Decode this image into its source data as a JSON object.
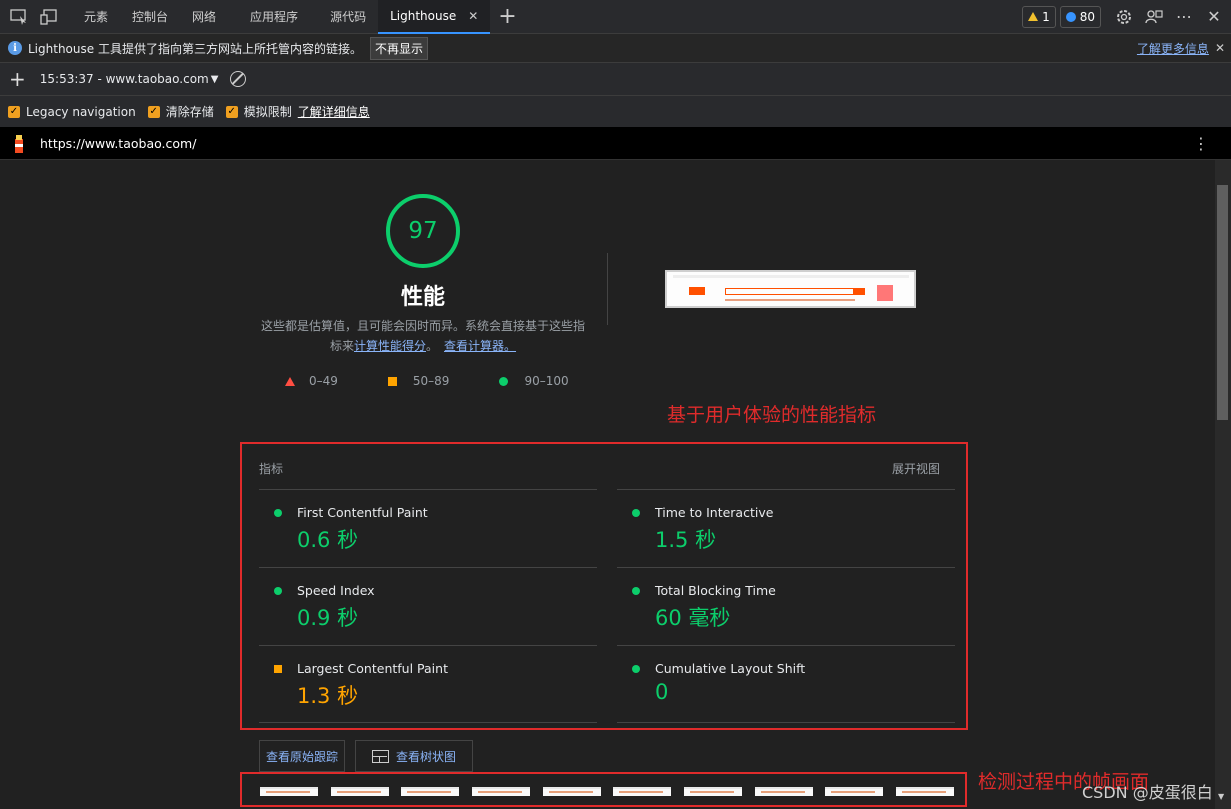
{
  "tabs": {
    "items": [
      "元素",
      "控制台",
      "网络",
      "应用程序",
      "源代码",
      "Lighthouse"
    ],
    "warnings": "1",
    "issues": "80"
  },
  "infobar": {
    "message": "Lighthouse 工具提供了指向第三方网站上所托管内容的链接。",
    "dismiss": "不再显示",
    "learn_more": "了解更多信息"
  },
  "toolbar": {
    "report_select": "15:53:37 - www.taobao.com"
  },
  "options": {
    "legacy": "Legacy navigation",
    "clear_storage": "清除存储",
    "throttling": "模拟限制",
    "learn_more": "了解详细信息"
  },
  "url": "https://www.taobao.com/",
  "summary": {
    "score": "97",
    "title": "性能",
    "desc_1": "这些都是估算值，且可能会因时而异。系统会直接基于这些指",
    "desc_2": "标来",
    "calc_link": "计算性能得分",
    "desc_3": "。",
    "calculator_link": "查看计算器。",
    "legend": [
      "0–49",
      "50–89",
      "90–100"
    ]
  },
  "annotations": {
    "metrics_note": "基于用户体验的性能指标",
    "film_note": "检测过程中的帧画面"
  },
  "metrics": {
    "header": "指标",
    "expand": "展开视图",
    "fcp_label": "First Contentful Paint",
    "fcp_value": "0.6 秒",
    "tti_label": "Time to Interactive",
    "tti_value": "1.5 秒",
    "si_label": "Speed Index",
    "si_value": "0.9 秒",
    "tbt_label": "Total Blocking Time",
    "tbt_value": "60 毫秒",
    "lcp_label": "Largest Contentful Paint",
    "lcp_value": "1.3 秒",
    "cls_label": "Cumulative Layout Shift",
    "cls_value": "0"
  },
  "buttons": {
    "trace": "查看原始跟踪",
    "treemap": "查看树状图"
  },
  "watermark": "CSDN @皮蛋很白",
  "colors": {
    "pass": "#0cce6b",
    "average": "#ffa400",
    "fail": "#ff4e42",
    "annotation": "#e02b2b"
  }
}
